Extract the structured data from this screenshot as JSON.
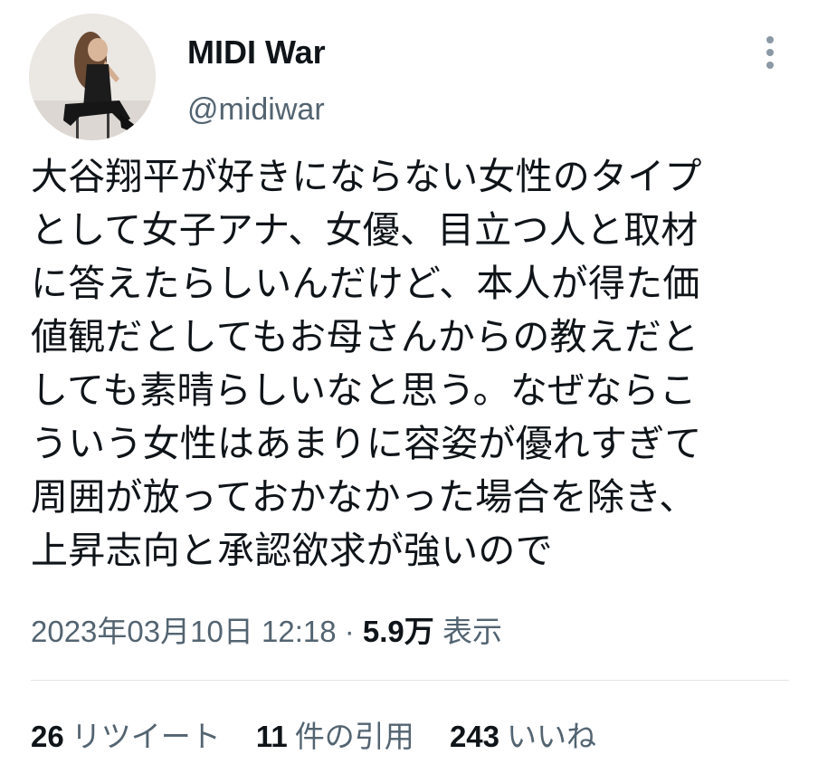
{
  "author": {
    "display_name": "MIDI War",
    "handle": "@midiwar"
  },
  "tweet": {
    "lines": [
      "大谷翔平が好きにならない女性のタイプ",
      "として女子アナ、女優、目立つ人と取材",
      "に答えたらしいんだけど、本人が得た価",
      "値観だとしてもお母さんからの教えだと",
      "しても素晴らしいなと思う。なぜならこ",
      "ういう女性はあまりに容姿が優れすぎて",
      "周囲が放っておかなかった場合を除き、",
      "上昇志向と承認欲求が強いので"
    ]
  },
  "meta": {
    "timestamp": "2023年03月10日 12:18",
    "separator": " · ",
    "views_count": "5.9万",
    "views_label": " 表示"
  },
  "stats": {
    "retweets": {
      "count": "26",
      "label": "リツイート"
    },
    "quotes": {
      "count": "11",
      "label": "件の引用"
    },
    "likes": {
      "count": "243",
      "label": "いいね"
    }
  },
  "icons": {
    "more": "more-vertical-icon"
  },
  "colors": {
    "text_primary": "#0f1419",
    "text_secondary": "#536471",
    "divider": "#e1e6ea",
    "more_dots": "#8b98a5"
  }
}
